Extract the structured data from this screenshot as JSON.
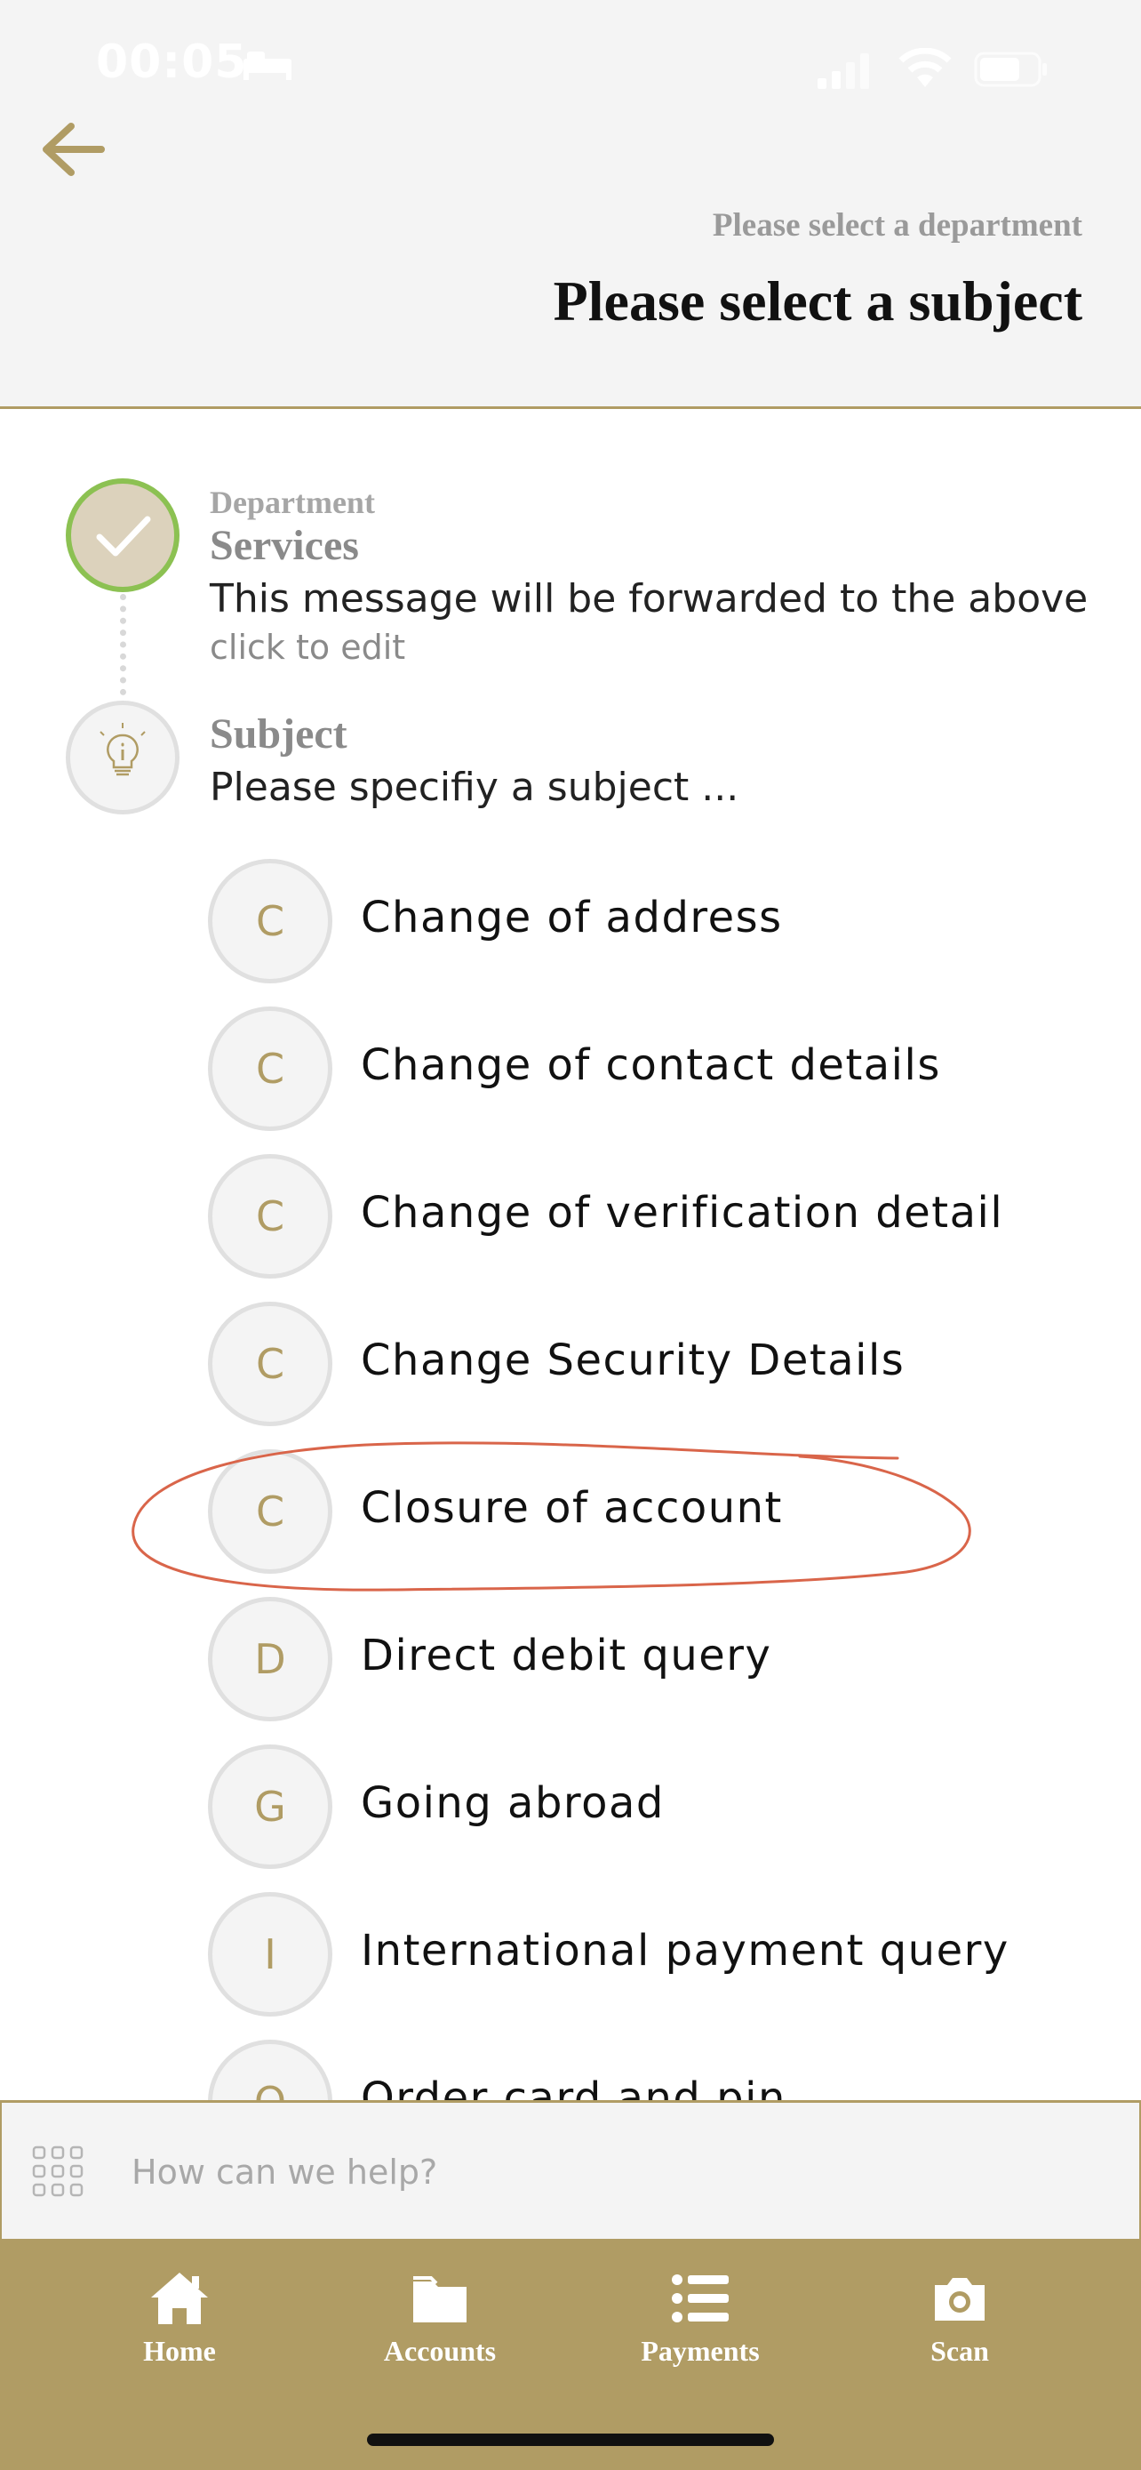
{
  "status_bar": {
    "time": "00:05"
  },
  "header": {
    "subtitle": "Please select a department",
    "title": "Please select a subject"
  },
  "steps": {
    "department": {
      "caption": "Department",
      "value": "Services",
      "note": "This message will be forwarded to the above",
      "edit_label": "click to edit"
    },
    "subject": {
      "heading": "Subject",
      "prompt": "Please specifiy a subject ..."
    }
  },
  "subjects": [
    {
      "letter": "C",
      "label": "Change of address"
    },
    {
      "letter": "C",
      "label": "Change of contact details"
    },
    {
      "letter": "C",
      "label": "Change of verification detail"
    },
    {
      "letter": "C",
      "label": "Change Security Details"
    },
    {
      "letter": "C",
      "label": "Closure of account",
      "annotated": true
    },
    {
      "letter": "D",
      "label": "Direct debit query"
    },
    {
      "letter": "G",
      "label": "Going abroad"
    },
    {
      "letter": "I",
      "label": "International payment query"
    },
    {
      "letter": "O",
      "label": "Order card and pin"
    }
  ],
  "help": {
    "placeholder": "How can we help?"
  },
  "tabs": [
    {
      "label": "Home",
      "icon": "home-icon"
    },
    {
      "label": "Accounts",
      "icon": "folder-icon"
    },
    {
      "label": "Payments",
      "icon": "list-icon"
    },
    {
      "label": "Scan",
      "icon": "camera-icon"
    }
  ],
  "colors": {
    "accent": "#b09c64",
    "header_bg": "#f4f4f4",
    "check_ring": "#8cc152",
    "annotation": "#d9654a"
  }
}
